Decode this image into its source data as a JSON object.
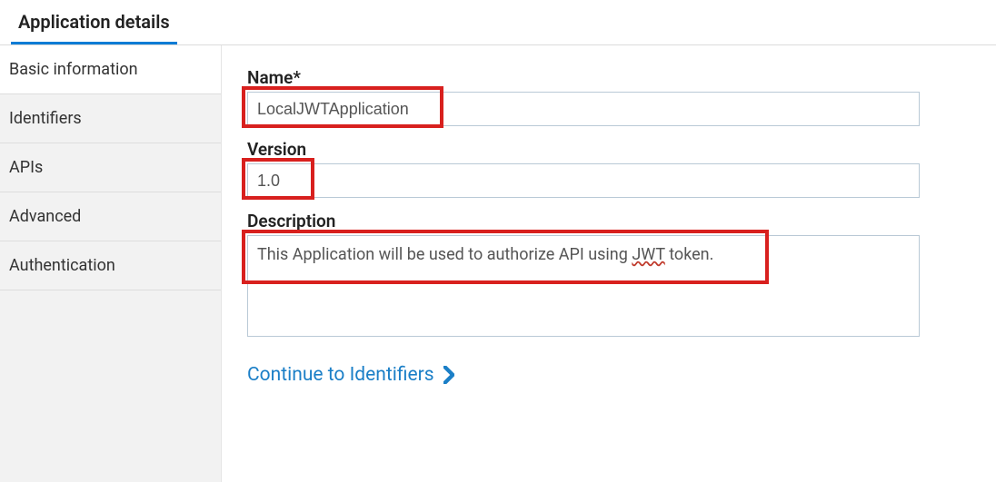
{
  "tabs": {
    "appDetails": "Application details"
  },
  "sidebar": {
    "items": [
      {
        "label": "Basic information"
      },
      {
        "label": "Identifiers"
      },
      {
        "label": "APIs"
      },
      {
        "label": "Advanced"
      },
      {
        "label": "Authentication"
      }
    ]
  },
  "form": {
    "name": {
      "label": "Name*",
      "value": "LocalJWTApplication"
    },
    "version": {
      "label": "Version",
      "value": "1.0"
    },
    "description": {
      "label": "Description",
      "value_pre": "This Application will be used to authorize API using ",
      "value_spell": "JWT",
      "value_post": " token."
    }
  },
  "continue": {
    "label": "Continue to Identifiers"
  }
}
